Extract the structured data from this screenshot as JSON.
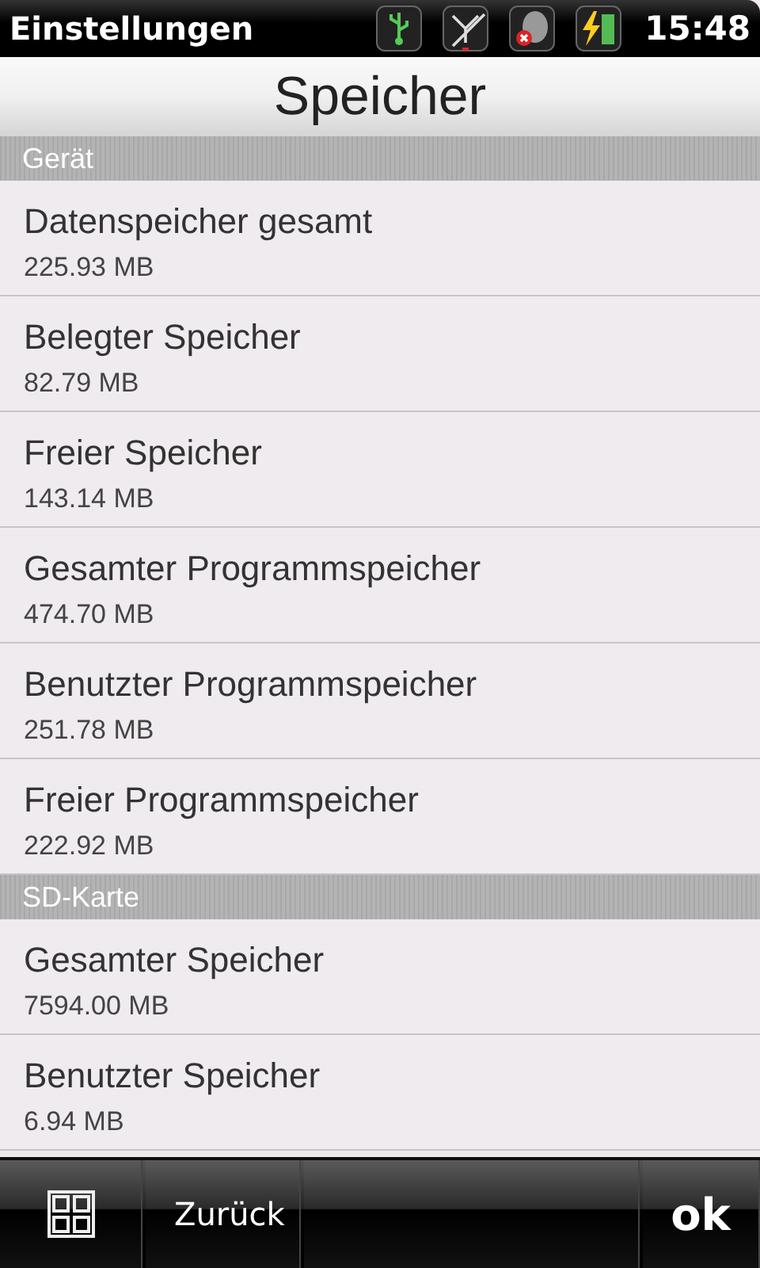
{
  "status_bar": {
    "title": "Einstellungen",
    "time": "15:48"
  },
  "header": {
    "title": "Speicher"
  },
  "sections": [
    {
      "title": "Gerät",
      "items": [
        {
          "label": "Datenspeicher gesamt",
          "value": "225.93 MB"
        },
        {
          "label": "Belegter Speicher",
          "value": "82.79 MB"
        },
        {
          "label": "Freier Speicher",
          "value": "143.14 MB"
        },
        {
          "label": "Gesamter Programmspeicher",
          "value": "474.70 MB"
        },
        {
          "label": "Benutzter Programmspeicher",
          "value": "251.78 MB"
        },
        {
          "label": "Freier Programmspeicher",
          "value": "222.92 MB"
        }
      ]
    },
    {
      "title": "SD-Karte",
      "items": [
        {
          "label": "Gesamter Speicher",
          "value": "7594.00 MB"
        },
        {
          "label": "Benutzter Speicher",
          "value": "6.94 MB"
        }
      ]
    }
  ],
  "bottom_bar": {
    "back": "Zurück",
    "ok": "ok"
  }
}
